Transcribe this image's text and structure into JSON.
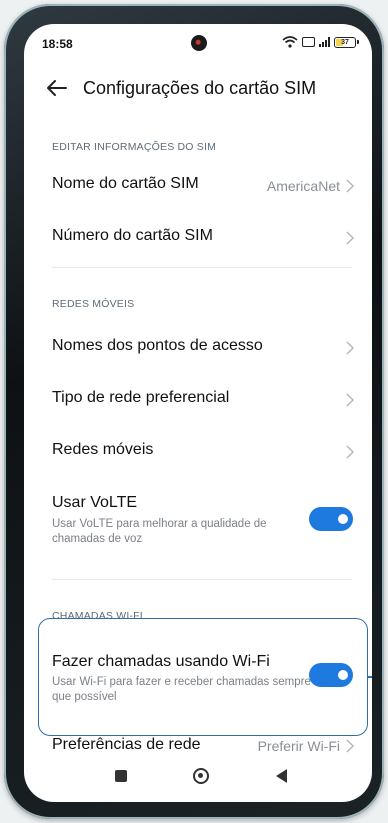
{
  "status_bar": {
    "time": "18:58",
    "battery": "37"
  },
  "header": {
    "title": "Configurações do cartão SIM"
  },
  "sections": {
    "edit_info": {
      "header": "EDITAR INFORMAÇÕES DO SIM",
      "sim_name": {
        "label": "Nome do cartão SIM",
        "value": "AmericaNet"
      },
      "sim_number": {
        "label": "Número do cartão SIM"
      }
    },
    "mobile": {
      "header": "REDES MÓVEIS",
      "apn": {
        "label": "Nomes dos pontos de acesso"
      },
      "network_type": {
        "label": "Tipo de rede preferencial"
      },
      "mobile_networks": {
        "label": "Redes móveis"
      },
      "volte": {
        "label": "Usar VoLTE",
        "description": "Usar VoLTE para melhorar a qualidade de chamadas de voz",
        "enabled": true
      }
    },
    "wifi_calls": {
      "header": "CHAMADAS WI-FI",
      "wifi_calling": {
        "label": "Fazer chamadas usando Wi-Fi",
        "description": "Usar Wi-Fi para fazer e receber chamadas sempre que possível",
        "enabled": true
      },
      "network_pref": {
        "label": "Preferências de rede",
        "value": "Preferir Wi-Fi"
      }
    }
  },
  "colors": {
    "accent": "#1f7ae0",
    "highlight": "#2f6fa8"
  }
}
